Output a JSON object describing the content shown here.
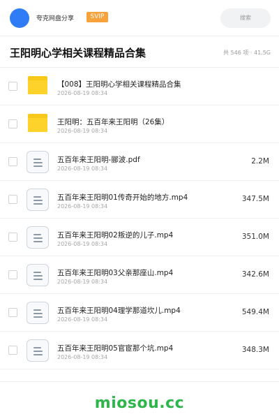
{
  "header": {
    "account_name": "夸克网盘分享",
    "badge": "SVIP",
    "search_placeholder": "搜索",
    "avatar_color": "#2f7cf6",
    "badge_color": "#f7a23b"
  },
  "share": {
    "title": "王阳明心学相关课程精品合集",
    "summary": "共 546 项 · 41.5G"
  },
  "files": [
    {
      "type": "folder",
      "name": "【008】王阳明心学相关课程精品合集",
      "date": "2026-08-19 08:34",
      "size": ""
    },
    {
      "type": "folder",
      "name": "王阳明：五百年来王阳明（26集）",
      "date": "2026-08-19 08:34",
      "size": ""
    },
    {
      "type": "file",
      "name": "五百年来王阳明-郦波.pdf",
      "date": "2026-08-19 08:34",
      "size": "2.2M"
    },
    {
      "type": "file",
      "name": "五百年来王阳明01传奇开始的地方.mp4",
      "date": "2026-08-19 08:34",
      "size": "347.5M"
    },
    {
      "type": "file",
      "name": "五百年来王阳明02叛逆的儿子.mp4",
      "date": "2026-08-19 08:34",
      "size": "351.0M"
    },
    {
      "type": "file",
      "name": "五百年来王阳明03父亲那座山.mp4",
      "date": "2026-08-19 08:34",
      "size": "342.6M"
    },
    {
      "type": "file",
      "name": "五百年来王阳明04理学那道坎儿.mp4",
      "date": "2026-08-19 08:34",
      "size": "549.4M"
    },
    {
      "type": "file",
      "name": "五百年来王阳明05官宦那个坑.mp4",
      "date": "2026-08-19 08:34",
      "size": "348.3M"
    }
  ],
  "footer": {
    "watermark": "miosou.cc",
    "watermark_color": "#2db64a"
  }
}
